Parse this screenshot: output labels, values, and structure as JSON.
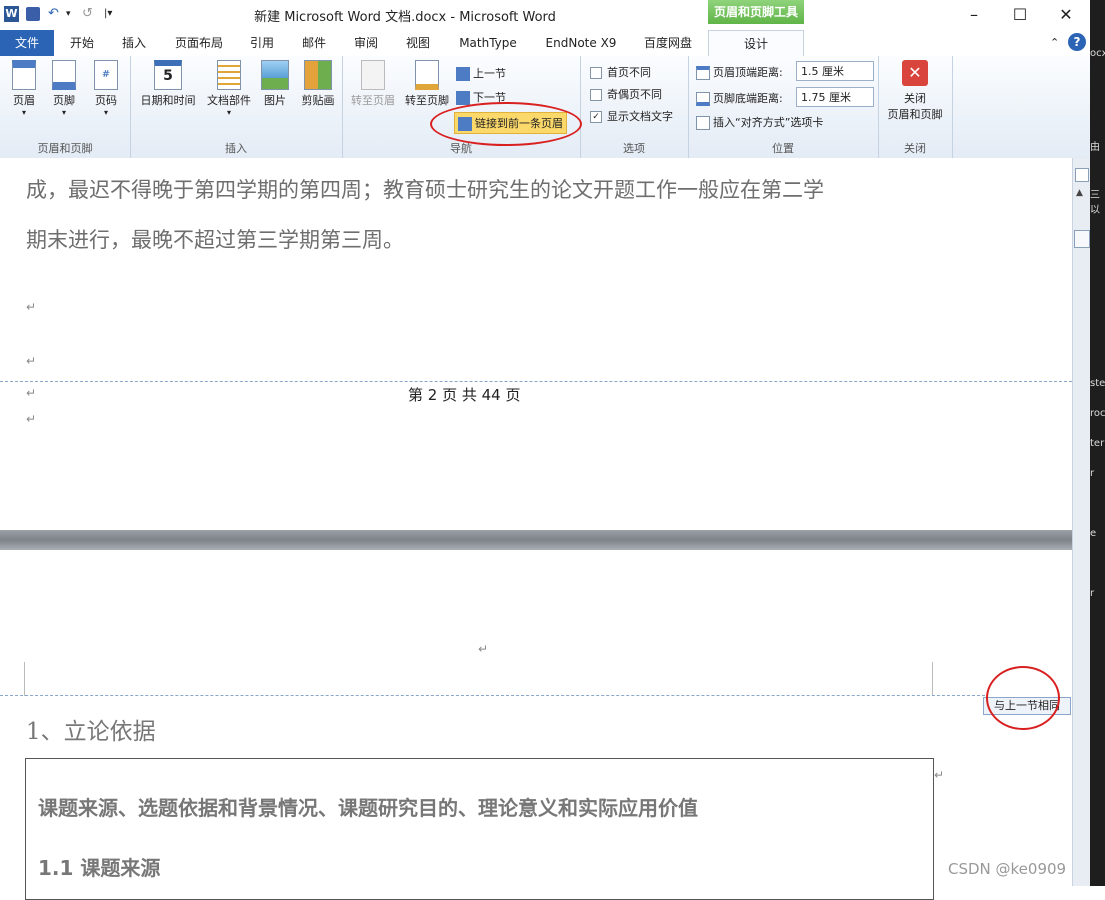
{
  "window": {
    "title": "新建 Microsoft Word 文档.docx - Microsoft Word",
    "context_tab": "页眉和页脚工具"
  },
  "quick_access": {
    "app_icon": "W",
    "undo": "↶",
    "redo": "↺"
  },
  "tabs": [
    "文件",
    "开始",
    "插入",
    "页面布局",
    "引用",
    "邮件",
    "审阅",
    "视图",
    "MathType",
    "EndNote X9",
    "百度网盘",
    "设计"
  ],
  "ribbon": {
    "group_header_footer": {
      "label": "页眉和页脚",
      "buttons": [
        "页眉",
        "页脚",
        "页码"
      ]
    },
    "group_insert": {
      "label": "插入",
      "buttons": [
        "日期和时间",
        "文档部件",
        "图片",
        "剪贴画"
      ]
    },
    "group_nav": {
      "label": "导航",
      "goto_header": "转至页眉",
      "goto_footer": "转至页脚",
      "prev": "上一节",
      "next": "下一节",
      "link_prev": "链接到前一条页眉"
    },
    "group_options": {
      "label": "选项",
      "first_page": "首页不同",
      "odd_even": "奇偶页不同",
      "show_text": "显示文档文字"
    },
    "group_position": {
      "label": "位置",
      "header_top": "页眉顶端距离:",
      "header_top_val": "1.5 厘米",
      "footer_bottom": "页脚底端距离:",
      "footer_bottom_val": "1.75 厘米",
      "insert_align": "插入“对齐方式”选项卡"
    },
    "group_close": {
      "label": "关闭",
      "close": "关闭",
      "close_sub": "页眉和页脚"
    }
  },
  "document": {
    "line1": "成，最迟不得晚于第四学期的第四周；教育硕士研究生的论文开题工作一般应在第二学",
    "line2": "期末进行，最晚不超过第三学期第三周。",
    "para_mark": "↵",
    "footer_text": "第 2 页 共 44 页",
    "same_as_prev": "与上一节相同",
    "heading": "1、立论依据",
    "box_line1": "课题来源、选题依据和背景情况、课题研究目的、理论意义和实际应用价值",
    "box_line2": "1.1 课题来源"
  },
  "right_edge": [
    "ocx",
    "由",
    "三以",
    "ste",
    "roc",
    "ter",
    "r",
    "e",
    "r"
  ],
  "watermark": "CSDN @ke0909"
}
